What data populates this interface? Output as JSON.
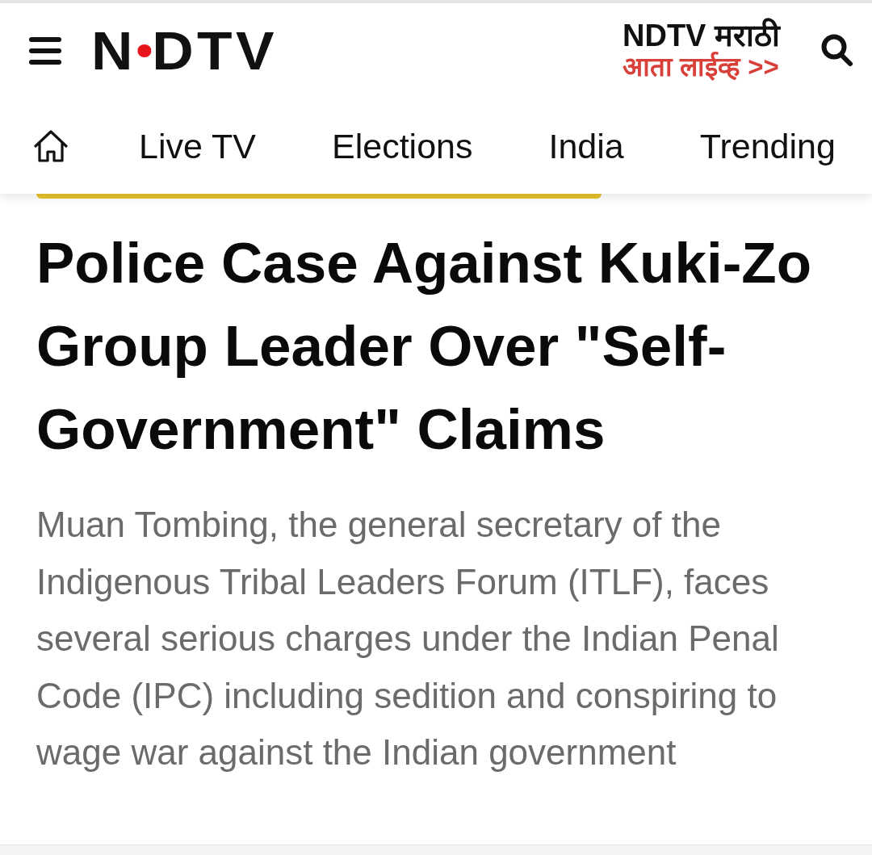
{
  "header": {
    "logo": "NDTV",
    "promo": {
      "title": "NDTV मराठी",
      "link": "आता लाईव्ह >>"
    }
  },
  "nav": {
    "items": [
      {
        "label": "Live TV"
      },
      {
        "label": "Elections"
      },
      {
        "label": "India"
      },
      {
        "label": "Trending"
      }
    ]
  },
  "article": {
    "headline": "Police Case Against Kuki-Zo Group Leader Over \"Self-Government\" Claims",
    "summary": "Muan Tombing, the general secretary of the Indigenous Tribal Leaders Forum (ITLF), faces several serious charges under the Indian Penal Code (IPC) including sedition and conspiring to wage war against the Indian government"
  }
}
